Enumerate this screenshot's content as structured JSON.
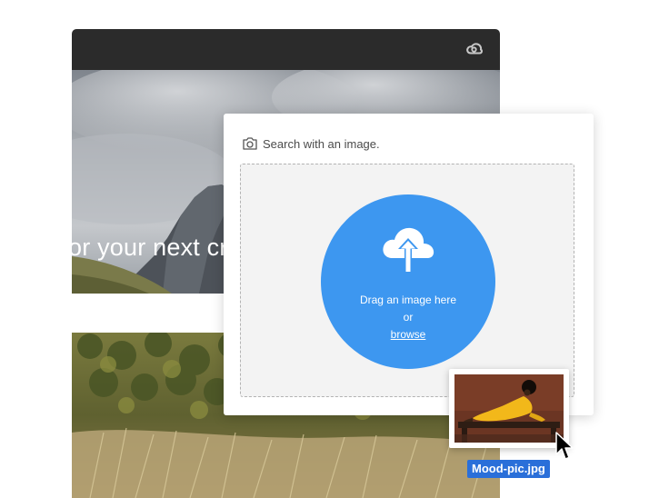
{
  "search": {
    "title": "Search with an image.",
    "drop_text_line1": "Drag an image here",
    "drop_text_line2": "or",
    "browse_label": "browse"
  },
  "hero": {
    "text": "or your next cre"
  },
  "drag": {
    "filename": "Mood-pic.jpg"
  },
  "icons": {
    "titlebar": "creative-cloud-icon",
    "header": "camera-icon",
    "upload": "cloud-upload-icon",
    "cursor": "mouse-pointer-icon"
  },
  "colors": {
    "accent": "#3d97f0",
    "titlebar": "#2b2b2b",
    "filename_tag": "#2a6fd9"
  }
}
